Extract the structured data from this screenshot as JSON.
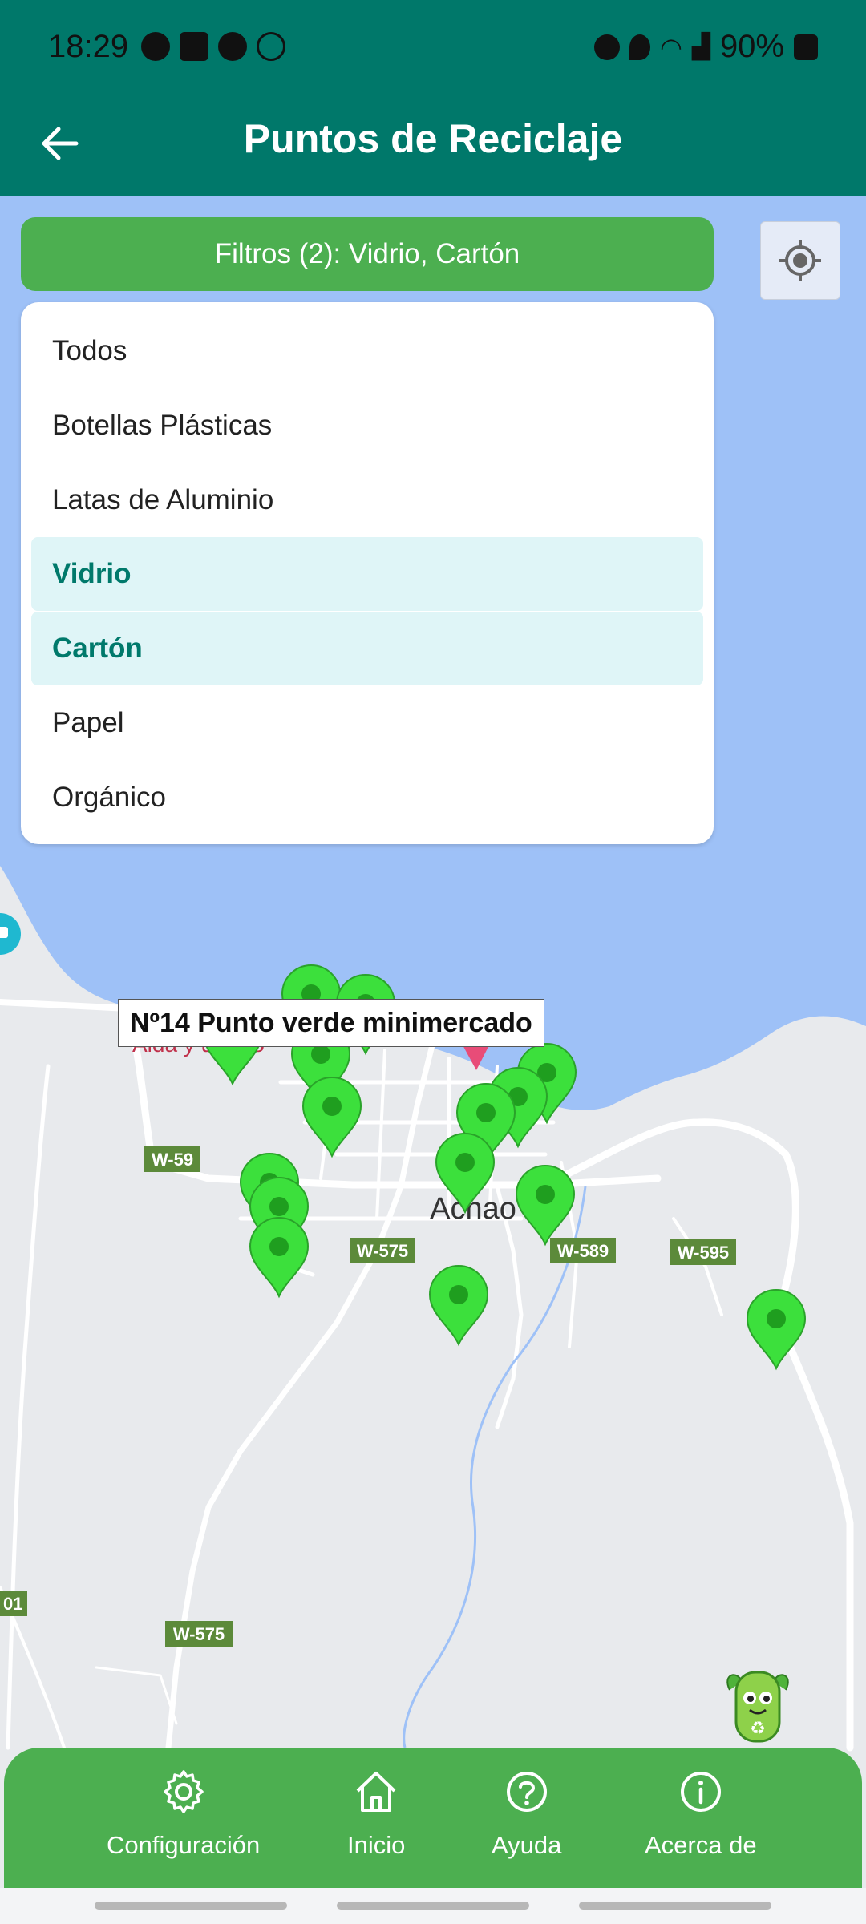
{
  "status_bar": {
    "time": "18:29",
    "battery": "90%"
  },
  "app_bar": {
    "title": "Puntos de Reciclaje"
  },
  "filter": {
    "label": "Filtros (2): Vidrio, Cartón",
    "options": [
      {
        "label": "Todos",
        "selected": false
      },
      {
        "label": "Botellas Plásticas",
        "selected": false
      },
      {
        "label": "Latas de Aluminio",
        "selected": false
      },
      {
        "label": "Vidrio",
        "selected": true
      },
      {
        "label": "Cartón",
        "selected": true
      },
      {
        "label": "Papel",
        "selected": false
      },
      {
        "label": "Orgánico",
        "selected": false
      }
    ]
  },
  "map": {
    "town_label": "Achao",
    "partial_label": "Alda    y    uranto",
    "edge_road_label": "01",
    "road_labels": [
      "W-59",
      "W-575",
      "W-589",
      "W-595",
      "W-575"
    ],
    "tooltip": "Nº14 Punto verde minimercado",
    "colors": {
      "water": "#9ec1f7",
      "land": "#e8eaed",
      "marker": "#3ce03c",
      "road_shield": "#5c8a3a"
    }
  },
  "bottom_nav": {
    "items": [
      {
        "label": "Configuración",
        "icon": "gear-icon"
      },
      {
        "label": "Inicio",
        "icon": "home-icon"
      },
      {
        "label": "Ayuda",
        "icon": "help-icon"
      },
      {
        "label": "Acerca de",
        "icon": "info-icon"
      }
    ]
  },
  "colors": {
    "app_bar": "#00786a",
    "accent_green": "#4caf50",
    "selected_bg": "#dff5f7",
    "selected_text": "#00796b"
  }
}
